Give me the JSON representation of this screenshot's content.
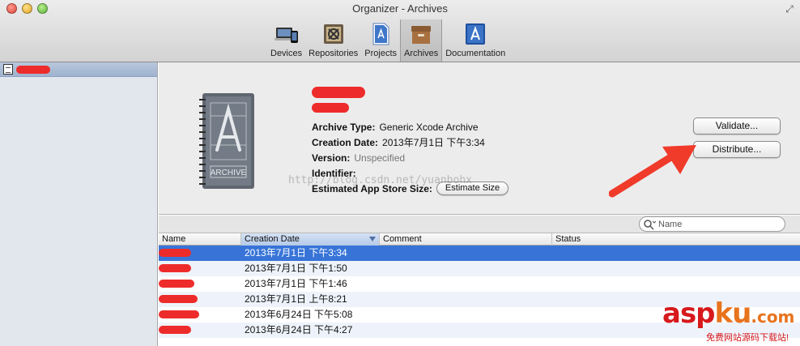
{
  "window": {
    "title": "Organizer - Archives"
  },
  "toolbar": {
    "items": [
      {
        "label": "Devices",
        "icon": "devices-icon"
      },
      {
        "label": "Repositories",
        "icon": "repositories-icon"
      },
      {
        "label": "Projects",
        "icon": "projects-icon"
      },
      {
        "label": "Archives",
        "icon": "archives-icon",
        "active": true
      },
      {
        "label": "Documentation",
        "icon": "documentation-icon"
      }
    ]
  },
  "archive": {
    "icon_label": "ARCHIVE",
    "fields": {
      "archive_type_label": "Archive Type:",
      "archive_type": "Generic Xcode Archive",
      "creation_date_label": "Creation Date:",
      "creation_date": "2013年7月1日 下午3:34",
      "version_label": "Version:",
      "version": "Unspecified",
      "identifier_label": "Identifier:",
      "identifier": "",
      "estimated_size_label": "Estimated App Store Size:"
    },
    "estimate_button": "Estimate Size",
    "validate_button": "Validate...",
    "distribute_button": "Distribute..."
  },
  "watermark": "http://blog.csdn.net/yuanbohx",
  "search": {
    "placeholder": "Name"
  },
  "table": {
    "columns": [
      "Name",
      "Creation Date",
      "Comment",
      "Status"
    ],
    "sorted_column": "Creation Date",
    "rows": [
      {
        "date": "2013年7月1日 下午3:34",
        "comment": "",
        "status": "",
        "selected": true
      },
      {
        "date": "2013年7月1日 下午1:50",
        "comment": "",
        "status": ""
      },
      {
        "date": "2013年7月1日 下午1:46",
        "comment": "",
        "status": ""
      },
      {
        "date": "2013年7月1日 上午8:21",
        "comment": "",
        "status": ""
      },
      {
        "date": "2013年6月24日 下午5:08",
        "comment": "",
        "status": ""
      },
      {
        "date": "2013年6月24日 下午4:27",
        "comment": "",
        "status": ""
      }
    ]
  },
  "logo": {
    "asp": "asp",
    "ku": "ku",
    "com": ".com",
    "tagline": "免费网站源码下载站!"
  },
  "colors": {
    "selection": "#3874d8",
    "redaction": "#ee2b2b",
    "arrow": "#f03a2a",
    "logo_red": "#d7191c"
  }
}
